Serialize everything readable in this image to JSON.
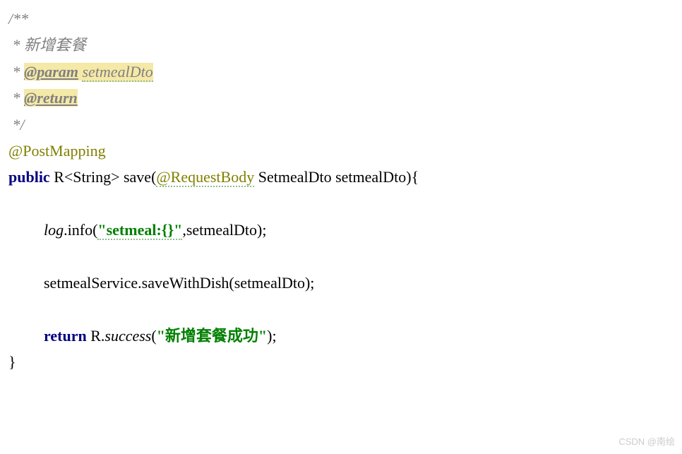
{
  "comment": {
    "open": "/**",
    "line1_prefix": " * ",
    "line1_text": "新增套餐",
    "line2_prefix": " * ",
    "line2_tag": "@param",
    "line2_space": " ",
    "line2_param": "setmealDto",
    "line3_prefix": " * ",
    "line3_tag": "@return",
    "close": " */"
  },
  "annotation": "@PostMapping",
  "method": {
    "keyword_public": "public",
    "return_type": " R<String> save(",
    "anno_requestbody": "@RequestBody",
    "params": " SetmealDto setmealDto){",
    "close_brace": "}"
  },
  "body": {
    "log_var": "log",
    "log_call": ".info(",
    "log_string": "\"setmeal:{}\"",
    "log_after": ",setmealDto);",
    "service_call": "setmealService.saveWithDish(setmealDto);",
    "return_kw": "return",
    "return_mid": " R.",
    "success_method": "success",
    "success_open": "(",
    "success_string": "\"新增套餐成功\"",
    "success_close": ");"
  },
  "watermark": "CSDN @南绘"
}
